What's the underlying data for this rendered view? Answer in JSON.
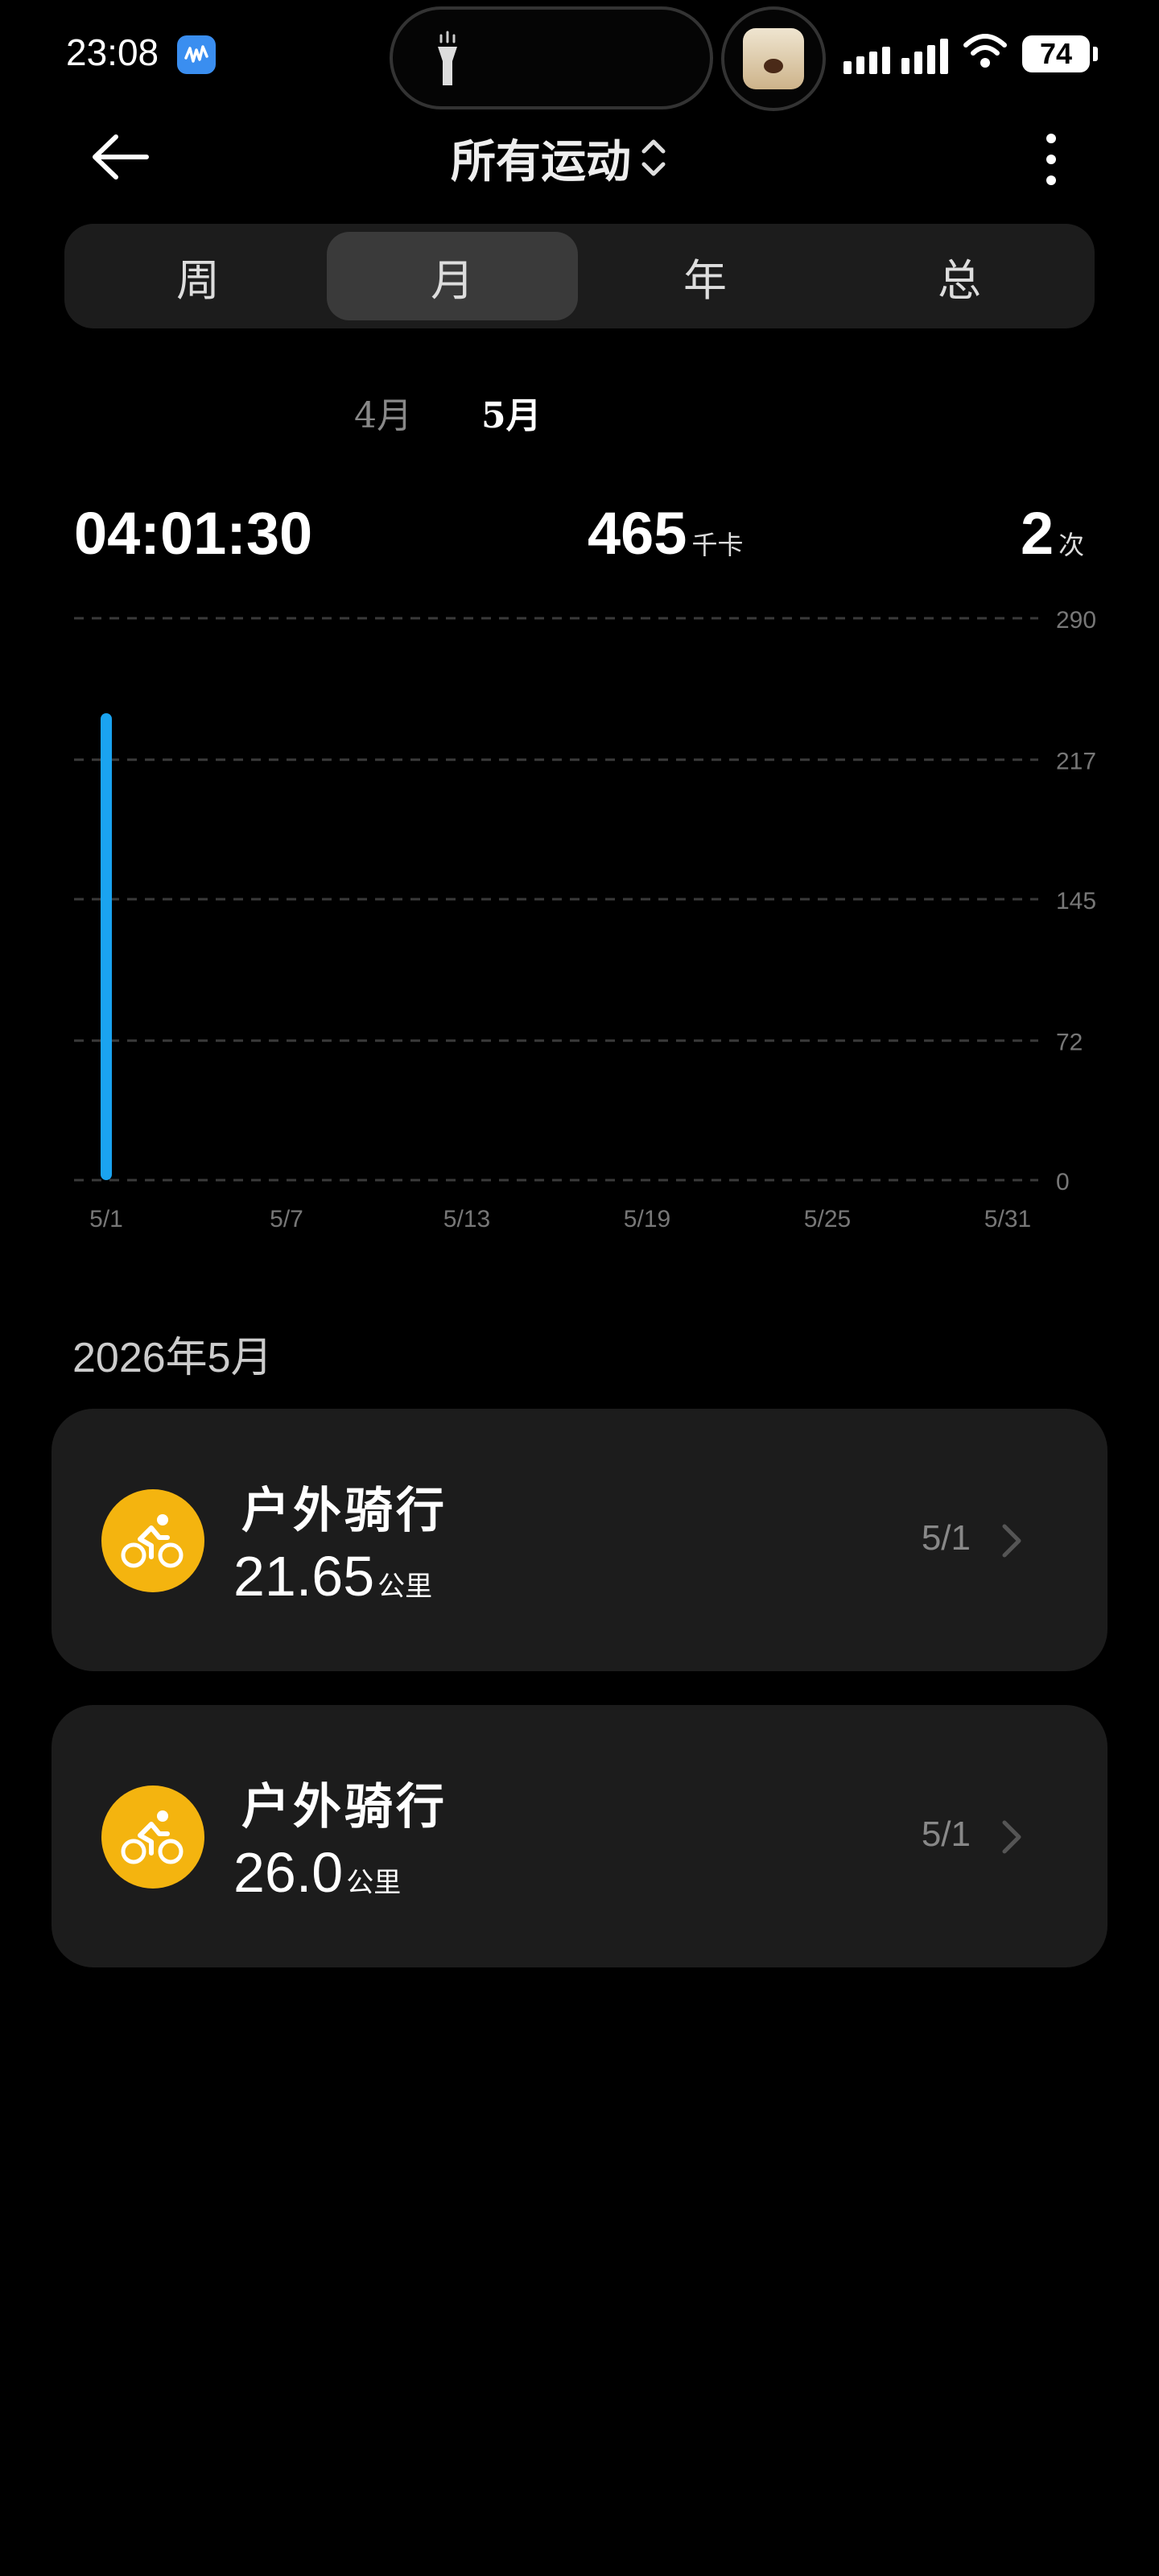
{
  "status_bar": {
    "time": "23:08",
    "battery": "74",
    "icons": [
      "app-notification-icon",
      "flashlight-icon",
      "music-album-icon",
      "signal-icon",
      "wifi-icon",
      "battery-icon"
    ]
  },
  "header": {
    "title": "所有运动",
    "back_icon": "arrow-left-icon",
    "sort_icon": "chevron-up-down-icon",
    "more_icon": "more-vertical-icon"
  },
  "segmented": {
    "tabs": [
      {
        "label": "周",
        "active": false
      },
      {
        "label": "月",
        "active": true
      },
      {
        "label": "年",
        "active": false
      },
      {
        "label": "总",
        "active": false
      }
    ]
  },
  "month_tabs": {
    "prev": "4月",
    "current": "5月"
  },
  "stats": {
    "duration": "04:01:30",
    "calories": "465",
    "calories_unit": "千卡",
    "count": "2",
    "count_unit": "次"
  },
  "chart_data": {
    "type": "bar",
    "x_ticks": [
      "5/1",
      "5/7",
      "5/13",
      "5/19",
      "5/25",
      "5/31"
    ],
    "y_ticks": [
      "290",
      "217",
      "145",
      "72",
      "0"
    ],
    "ylim": [
      0,
      290
    ],
    "days": 31,
    "bars": [
      {
        "x": "5/1",
        "day": 1,
        "value": 241
      }
    ],
    "color": "#1aa3f0",
    "grid": true
  },
  "month_header": "2026年5月",
  "activities": [
    {
      "name": "户外骑行",
      "distance": "21.65",
      "unit": "公里",
      "date": "5/1",
      "icon": "cycling-icon"
    },
    {
      "name": "户外骑行",
      "distance": "26.0",
      "unit": "公里",
      "date": "5/1",
      "icon": "cycling-icon"
    }
  ],
  "colors": {
    "background": "#000000",
    "card": "#1c1c1c",
    "accent_bar": "#1aa3f0",
    "activity_icon": "#f4b40f"
  }
}
